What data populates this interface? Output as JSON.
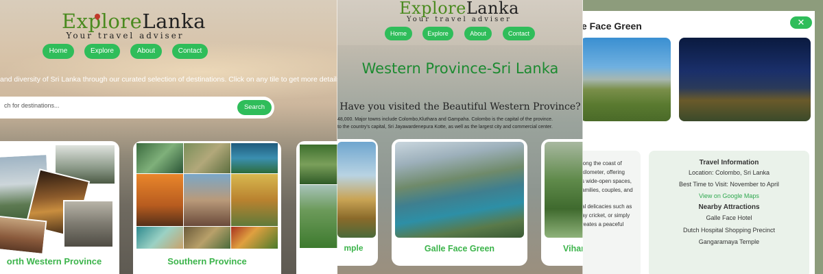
{
  "brand": {
    "name_part1": "Explore",
    "name_part2": "Lanka",
    "tagline": "Your travel adviser"
  },
  "nav": [
    "Home",
    "Explore",
    "About",
    "Contact"
  ],
  "home": {
    "intro": "and diversity of Sri Lanka through our curated selection of destinations. Click on any tile to get more details",
    "search_placeholder": "ch for destinations...",
    "search_button": "Search",
    "cards": [
      {
        "title": "orth Western Province"
      },
      {
        "title": "Southern Province"
      },
      {
        "title": ""
      }
    ]
  },
  "province": {
    "title": "Western Province-Sri Lanka",
    "subtitle": "Have you visited the Beautiful Western Province?",
    "para_line1": "48,000. Major towns include Colombo,Kluthara and Gampaha. Colombo is the capital of the province.",
    "para_line2": "to the country's capital, Sri Jayawardenepura Kotte, as well as the largest city and commercial center.",
    "cards": [
      {
        "title": "mple"
      },
      {
        "title": "Galle Face Green"
      },
      {
        "title": "Vihar"
      }
    ]
  },
  "modal": {
    "title": "le Face Green",
    "close_label": "✕",
    "description_lines": [
      "long the coast of",
      "kilometer, offering",
      "s wide-open spaces,",
      "amilies, couples, and",
      "",
      "al delicacies such as",
      "ay cricket, or simply",
      "reates a peaceful"
    ],
    "info": {
      "heading": "Travel Information",
      "location": "Location: Colombo, Sri Lanka",
      "best_time": "Best Time to Visit: November to April",
      "maps_link": "View on Google Maps",
      "nearby_heading": "Nearby Attractions",
      "nearby": [
        "Galle Face Hotel",
        "Dutch Hospital Shopping Precinct",
        "Gangaramaya Temple"
      ]
    }
  },
  "colors": {
    "accent": "#2fbd5a",
    "title_green": "#3cb44b",
    "heading_green": "#1c8a30"
  }
}
